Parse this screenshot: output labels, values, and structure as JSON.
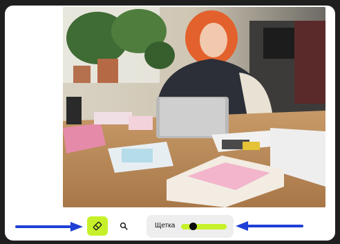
{
  "photo": {
    "alt": ""
  },
  "toolbar": {
    "eraser_icon": "eraser-icon",
    "search_icon": "magnifier-icon",
    "brush_label": "Щетка",
    "brush_size_fraction": 0.25,
    "accent_color": "#c6f12a"
  },
  "annotations": {
    "arrow_color": "#1f3fd6"
  }
}
